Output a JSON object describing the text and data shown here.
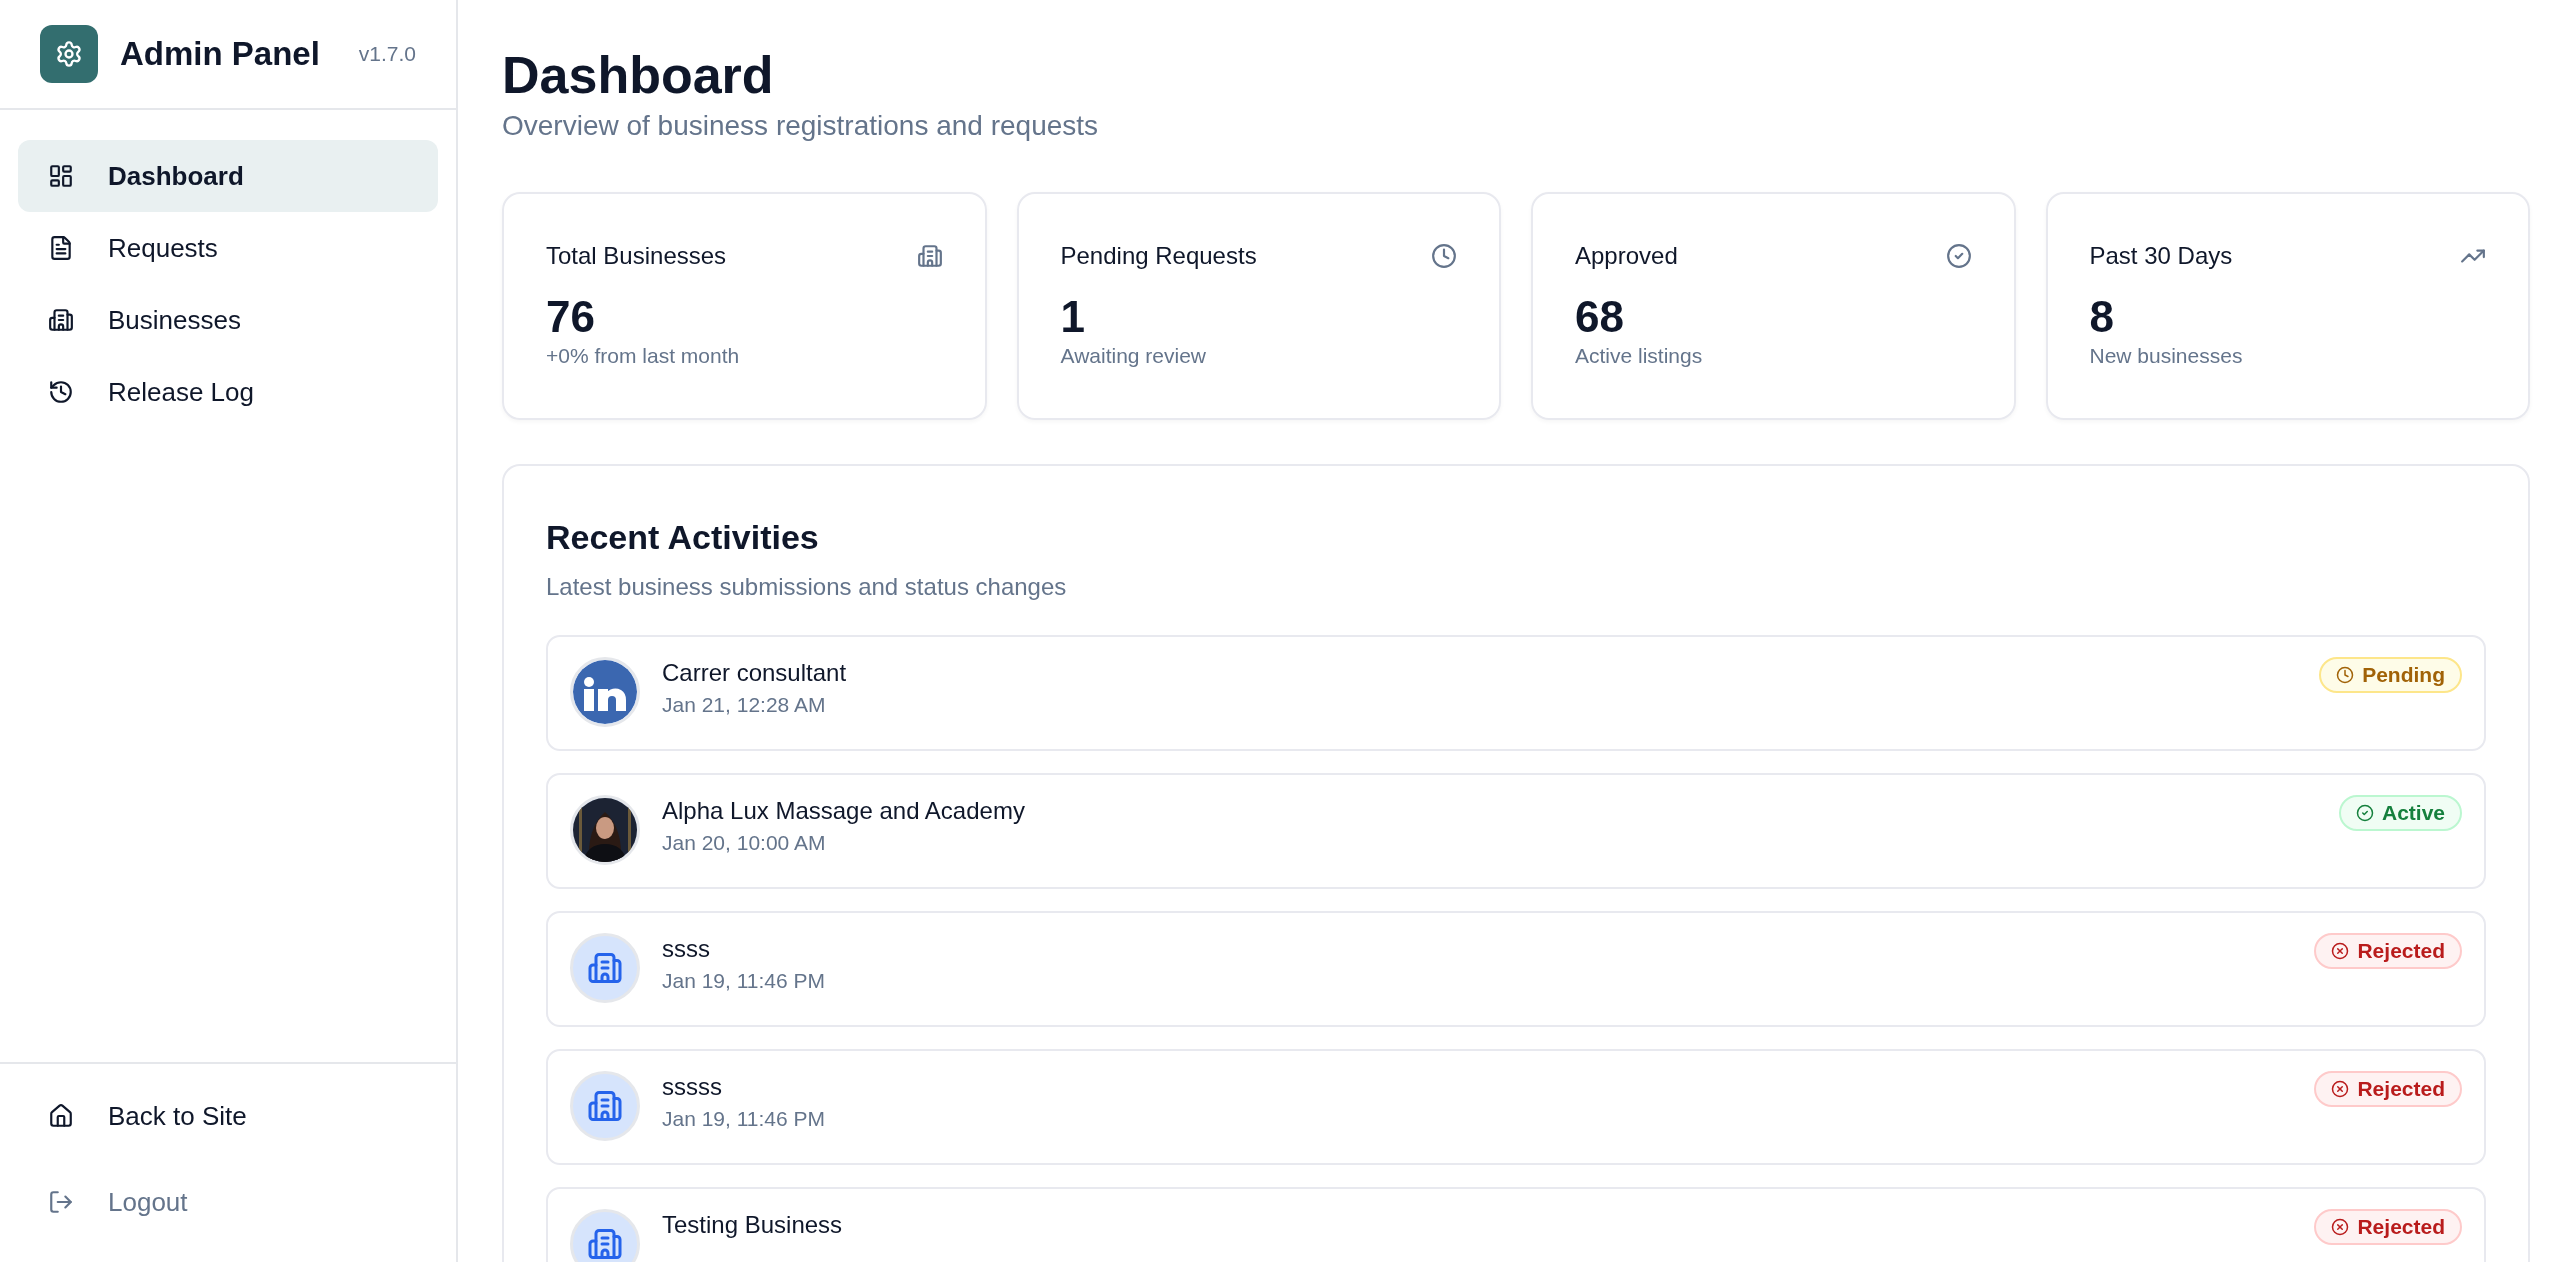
{
  "sidebar": {
    "brand": {
      "title": "Admin Panel",
      "version": "v1.7.0"
    },
    "items": [
      {
        "label": "Dashboard",
        "selected": true
      },
      {
        "label": "Requests",
        "selected": false
      },
      {
        "label": "Businesses",
        "selected": false
      },
      {
        "label": "Release Log",
        "selected": false
      }
    ],
    "footer_items": [
      {
        "label": "Back to Site",
        "muted": false
      },
      {
        "label": "Logout",
        "muted": true
      }
    ]
  },
  "header": {
    "title": "Dashboard",
    "subtitle": "Overview of business registrations and requests"
  },
  "stats": [
    {
      "title": "Total Businesses",
      "value": "76",
      "note": "+0% from last month"
    },
    {
      "title": "Pending Requests",
      "value": "1",
      "note": "Awaiting review"
    },
    {
      "title": "Approved",
      "value": "68",
      "note": "Active listings"
    },
    {
      "title": "Past 30 Days",
      "value": "8",
      "note": "New businesses"
    }
  ],
  "recent_activities": {
    "title": "Recent Activities",
    "subtitle": "Latest business submissions and status changes",
    "rows": [
      {
        "name": "Carrer consultant",
        "time": "Jan 21, 12:28 AM",
        "kind": "picture",
        "badge": {
          "label": "Pending",
          "kind": "pending"
        }
      },
      {
        "name": "Alpha Lux Massage and Academy",
        "time": "Jan 20, 10:00 AM",
        "kind": "picture",
        "badge": {
          "label": "Active",
          "kind": "active"
        }
      },
      {
        "name": "ssss",
        "time": "Jan 19, 11:46 PM",
        "kind": "icon",
        "badge": {
          "label": "Rejected",
          "kind": "rejected"
        }
      },
      {
        "name": "sssss",
        "time": "Jan 19, 11:46 PM",
        "kind": "icon",
        "badge": {
          "label": "Rejected",
          "kind": "rejected"
        }
      },
      {
        "name": "Testing Business",
        "kind": "icon",
        "badge": {
          "label": "Rejected",
          "kind": "rejected"
        }
      }
    ]
  }
}
